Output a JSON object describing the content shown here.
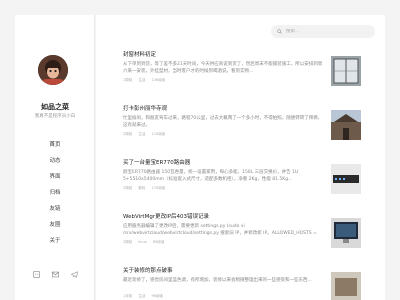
{
  "sidebar": {
    "site_name": "如品之菜",
    "site_desc": "我真不是程序员小白",
    "nav": [
      "首页",
      "动态",
      "界面",
      "归档",
      "友链",
      "友圈",
      "关于"
    ],
    "social_icons": [
      "wechat-icon",
      "email-icon",
      "telegram-icon"
    ]
  },
  "search": {
    "placeholder": "搜索..."
  },
  "posts": [
    {
      "title": "封窗材料初定",
      "excerpt": "从下单到到货，等了差不多21天时间，今天供应商说到货了，然后周末不能铺装施工，所以安排到周六来一安装，外挂型材，当时客户才的时候到喝酒说，看到实物...",
      "meta": [
        "1周前",
        "生活",
        "136阅读"
      ]
    },
    {
      "title": "打卡彭州丽华寺观",
      "excerpt": "忙里偷闲，和朋友驾车过来，路程70公里，过去大概两了一个多小时，不得拍照，随便转转了拜佛，这有就来过。",
      "meta": [
        "2周前",
        "生活",
        "110阅读"
      ]
    },
    {
      "title": "买了一台量宝ER770路由器",
      "excerpt": "颜宝ER770路由器 150瓦吞量，统一设置家用，每心多能，150L 三层交换价，并告 1U 5+5510x5400mm（标准嵌入式尺寸，适配多数机柜），净重 2Kg，性能 81.5Kg...",
      "meta": [
        "2周前",
        "数码",
        "170阅读"
      ]
    },
    {
      "title": "WebVirtMgr更改IP后403错误记录",
      "excerpt": "应用服务器编辑了更改IP后，需要更新 settings.py (sudo vi /srv/webvirtcloud/webvirtcloud/settings.py 搜索旧 IP，并修改新 IP。ALLOWED_HOSTS = ['新...",
      "meta": [
        "3周前",
        "linux",
        "89阅读"
      ]
    },
    {
      "title": "关于装修的那点破事",
      "excerpt": "最近装修了，感觉房间里蓝色调，有所增加，装修以来会稍微整理出来的一些感受和一些东西...",
      "meta": [
        "1月前",
        "生活",
        "96阅读"
      ]
    }
  ],
  "colors": {
    "background": "#f4f4f4",
    "panel": "#ffffff",
    "title": "#222222",
    "excerpt": "#888888"
  }
}
